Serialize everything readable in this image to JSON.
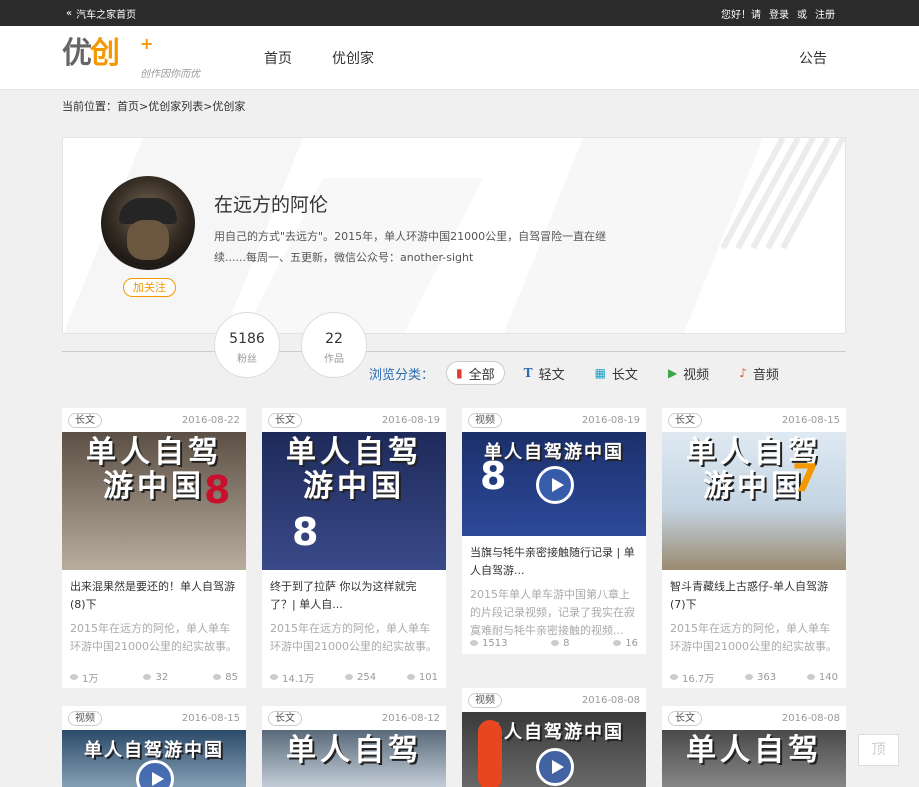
{
  "topbar": {
    "home_link": "汽车之家首页",
    "greeting": "您好！请",
    "login": "登录",
    "or": "或",
    "register": "注册"
  },
  "header": {
    "logo_text": "优创",
    "logo_slogan": "创作因你而优",
    "nav": [
      "首页",
      "优创家"
    ],
    "notice": "公告"
  },
  "breadcrumb": "当前位置：首页>优创家列表>优创家",
  "profile": {
    "name": "在远方的阿伦",
    "follow_label": "加关注",
    "description": "用自己的方式\"去远方\"。2015年，单人环游中国21000公里，自驾冒险一直在继续......每周一、五更新，微信公众号：another-sight",
    "stats": [
      {
        "value": "5186",
        "label": "粉丝"
      },
      {
        "value": "22",
        "label": "作品"
      }
    ]
  },
  "filters": {
    "label": "浏览分类：",
    "items": [
      {
        "label": "全部",
        "icon": "bookmark-icon",
        "color": "#e23a2e",
        "active": true
      },
      {
        "label": "轻文",
        "icon": "text-t-icon",
        "color": "#2a6db5",
        "active": false
      },
      {
        "label": "长文",
        "icon": "document-icon",
        "color": "#1fa0c8",
        "active": false
      },
      {
        "label": "视频",
        "icon": "video-icon",
        "color": "#3aa845",
        "active": false
      },
      {
        "label": "音频",
        "icon": "music-note-icon",
        "color": "#e0572a",
        "active": false
      }
    ]
  },
  "cards": [
    {
      "tag": "长文",
      "date": "2016-08-22",
      "thumb_title": "单人自驾",
      "thumb_title2": "游中国",
      "thumb_num": "8",
      "thumb_colors": [
        "#5c5046",
        "#b9ad9e"
      ],
      "title": "出来混果然是要还的！单人自驾游(8)下",
      "desc": "2015年在远方的阿伦，单人单车环游中国21000公里的纪实故事。",
      "views": "1万",
      "comments": "32",
      "likes": "85",
      "video": false
    },
    {
      "tag": "长文",
      "date": "2016-08-19",
      "thumb_title": "单人自驾",
      "thumb_title2": "游中国",
      "thumb_num": "8",
      "thumb_colors": [
        "#1e2a5a",
        "#3a4a8a"
      ],
      "title": "终于到了拉萨 你以为这样就完了？| 单人自...",
      "desc": "2015年在远方的阿伦，单人单车环游中国21000公里的纪实故事。",
      "views": "14.1万",
      "comments": "254",
      "likes": "101",
      "video": false
    },
    {
      "tag": "视频",
      "date": "2016-08-19",
      "thumb_title": "单人自驾游中国",
      "thumb_title2": "",
      "thumb_num": "8",
      "thumb_colors": [
        "#1b2f6a",
        "#2d4a9a"
      ],
      "title": "当旗与牦牛亲密接触随行记录 | 单人自驾游...",
      "desc": "2015年单人单车游中国第八章上的片段记录视频，记录了我实在寂寞难耐与牦牛亲密接触的视频...",
      "views": "1513",
      "comments": "8",
      "likes": "16",
      "video": true
    },
    {
      "tag": "长文",
      "date": "2016-08-15",
      "thumb_title": "单人自驾",
      "thumb_title2": "游中国",
      "thumb_num": "7",
      "thumb_colors": [
        "#dfe9f2",
        "#9a8a70"
      ],
      "title": "智斗青藏线上古惑仔-单人自驾游(7)下",
      "desc": "2015年在远方的阿伦，单人单车环游中国21000公里的纪实故事。",
      "views": "16.7万",
      "comments": "363",
      "likes": "140",
      "video": false
    },
    {
      "tag": "视频",
      "date": "2016-08-15",
      "thumb_title": "单人自驾游中国",
      "thumb_colors": [
        "#2c4a6a",
        "#8aa4b8"
      ],
      "video": true
    },
    {
      "tag": "长文",
      "date": "2016-08-12",
      "thumb_title": "单人自驾",
      "thumb_colors": [
        "#5a6a7a",
        "#c8d2dc"
      ],
      "video": false
    },
    {
      "tag": "视频",
      "date": "2016-08-08",
      "thumb_title": "单人自驾游中国",
      "thumb_colors": [
        "#3a3a3a",
        "#6a6a6a"
      ],
      "video": true
    },
    {
      "tag": "长文",
      "date": "2016-08-08",
      "thumb_title": "单人自驾",
      "thumb_colors": [
        "#4a4a4a",
        "#8a8a8a"
      ],
      "video": false
    }
  ],
  "back_to_top": "顶"
}
